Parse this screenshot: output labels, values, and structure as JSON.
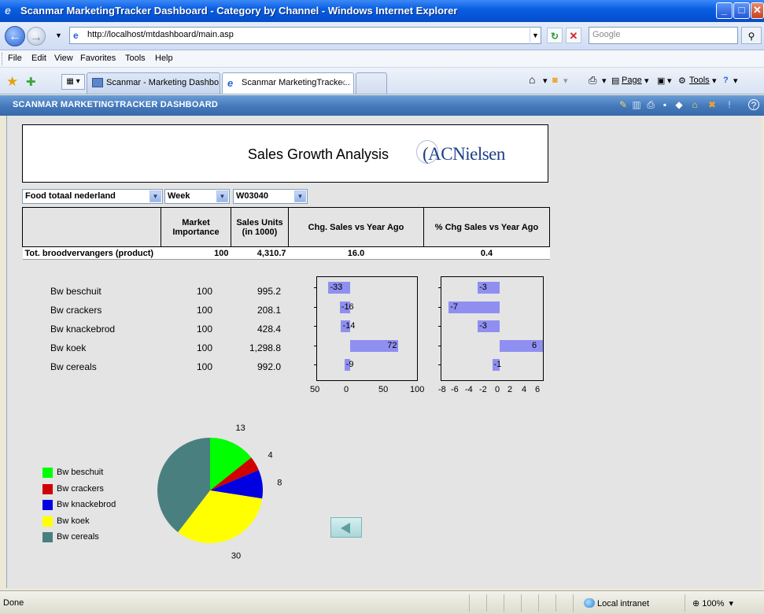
{
  "window": {
    "title": "Scanmar MarketingTracker Dashboard - Category by Channel - Windows Internet Explorer"
  },
  "address": {
    "url": "http://localhost/mtdashboard/main.asp",
    "search_placeholder": "Google"
  },
  "menu": [
    "File",
    "Edit",
    "View",
    "Favorites",
    "Tools",
    "Help"
  ],
  "tabs": [
    {
      "label": "Scanmar - Marketing Dashbo..."
    },
    {
      "label": "Scanmar MarketingTracke...",
      "close": "✕"
    }
  ],
  "commands": {
    "page": "Page",
    "tools": "Tools"
  },
  "app": {
    "name": "SCANMAR MARKETINGTRACKER DASHBOARD"
  },
  "report": {
    "title": "Sales Growth Analysis",
    "logo_text": "ACNielsen"
  },
  "filters": {
    "market": "Food totaal nederland",
    "period_type": "Week",
    "period": "W03040"
  },
  "table": {
    "headers": [
      "Market Importance",
      "Sales Units (in 1000)",
      "Chg. Sales vs Year Ago",
      "% Chg Sales vs Year Ago"
    ],
    "total": {
      "label": "Tot. broodvervangers (product)",
      "importance": "100",
      "units": "4,310.7",
      "chg": "16.0",
      "pct": "0.4"
    },
    "rows": [
      {
        "label": "Bw beschuit",
        "importance": "100",
        "units": "995.2"
      },
      {
        "label": "Bw crackers",
        "importance": "100",
        "units": "208.1"
      },
      {
        "label": "Bw knackebrod",
        "importance": "100",
        "units": "428.4"
      },
      {
        "label": "Bw koek",
        "importance": "100",
        "units": "1,298.8"
      },
      {
        "label": "Bw cereals",
        "importance": "100",
        "units": "992.0"
      }
    ]
  },
  "chart_data": [
    {
      "type": "bar",
      "orientation": "horizontal",
      "categories": [
        "Bw beschuit",
        "Bw crackers",
        "Bw knackebrod",
        "Bw koek",
        "Bw cereals"
      ],
      "values": [
        -33,
        -16,
        -14,
        72,
        -9
      ],
      "xlim": [
        -50,
        100
      ],
      "ticks": [
        "50",
        "0",
        "50",
        "100"
      ],
      "color": "#8f8ff1"
    },
    {
      "type": "bar",
      "orientation": "horizontal",
      "categories": [
        "Bw beschuit",
        "Bw crackers",
        "Bw knackebrod",
        "Bw koek",
        "Bw cereals"
      ],
      "values": [
        -3,
        -7,
        -3,
        6,
        -1
      ],
      "xlim": [
        -8,
        6
      ],
      "ticks": [
        "-8",
        "-6",
        "-4",
        "-2",
        "0",
        "2",
        "4",
        "6"
      ],
      "color": "#8f8ff1"
    },
    {
      "type": "pie",
      "series": [
        {
          "name": "Bw beschuit",
          "value": 13,
          "color": "#00ff00"
        },
        {
          "name": "Bw crackers",
          "value": 4,
          "color": "#d00000"
        },
        {
          "name": "Bw knackebrod",
          "value": 8,
          "color": "#0000e0"
        },
        {
          "name": "Bw koek",
          "value": 30,
          "color": "#ffff00"
        },
        {
          "name": "Bw cereals",
          "value": 36,
          "color": "#4a7f7f"
        }
      ]
    }
  ],
  "status": {
    "text": "Done",
    "zone": "Local intranet",
    "zoom": "100%"
  }
}
